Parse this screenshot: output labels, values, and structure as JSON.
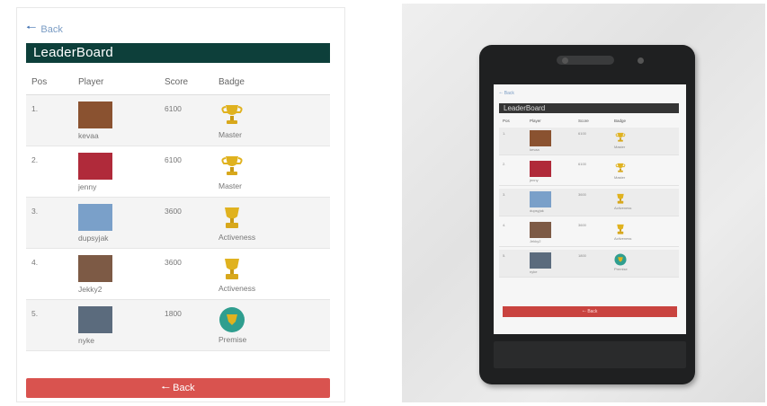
{
  "app": {
    "top_back_label": "Back",
    "title": "LeaderBoard",
    "columns": {
      "pos": "Pos",
      "player": "Player",
      "score": "Score",
      "badge": "Badge"
    },
    "rows": [
      {
        "pos": "1.",
        "player": "kevaa",
        "score": "6100",
        "badge": "Master",
        "avatar_color": "#8a5230",
        "badge_type": "trophy"
      },
      {
        "pos": "2.",
        "player": "jenny",
        "score": "6100",
        "badge": "Master",
        "avatar_color": "#b02a3a",
        "badge_type": "trophy"
      },
      {
        "pos": "3.",
        "player": "dupsyjak",
        "score": "3600",
        "badge": "Activeness",
        "avatar_color": "#7aa0c9",
        "badge_type": "cup"
      },
      {
        "pos": "4.",
        "player": "Jekky2",
        "score": "3600",
        "badge": "Activeness",
        "avatar_color": "#7d5a45",
        "badge_type": "cup"
      },
      {
        "pos": "5.",
        "player": "nyke",
        "score": "1800",
        "badge": "Premise",
        "avatar_color": "#5b6b7d",
        "badge_type": "shield"
      }
    ],
    "bottom_back_label": "Back"
  },
  "phone_screen": {
    "top_back_label": "Back",
    "title": "LeaderBoard",
    "columns": {
      "pos": "Pos",
      "player": "Player",
      "score": "Score",
      "badge": "Badge"
    },
    "rows": [
      {
        "pos": "1.",
        "player": "kevaa",
        "score": "6100",
        "badge": "Master"
      },
      {
        "pos": "2.",
        "player": "jenny",
        "score": "6100",
        "badge": "Master"
      },
      {
        "pos": "3.",
        "player": "dupsyjak",
        "score": "3600",
        "badge": "Activeness"
      },
      {
        "pos": "4.",
        "player": "Jekky2",
        "score": "3600",
        "badge": "Activeness"
      },
      {
        "pos": "5.",
        "player": "nyke",
        "score": "1800",
        "badge": "Premise"
      }
    ],
    "bottom_back_label": "Back"
  },
  "colors": {
    "title_bar": "#0d3f3a",
    "back_button": "#d9534f",
    "link": "#3e6fb0",
    "trophy_gold": "#e0b21f",
    "premise_green": "#2f9e8f"
  }
}
